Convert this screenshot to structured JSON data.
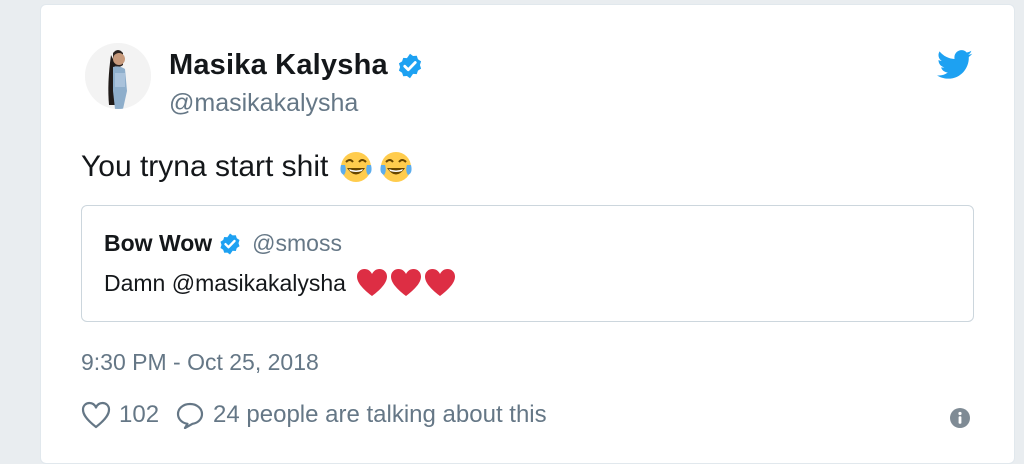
{
  "author": {
    "name": "Masika Kalysha",
    "handle": "@masikakalysha",
    "verified": true
  },
  "tweet": {
    "text": "You tryna start shit",
    "emojis": [
      "face-with-tears-of-joy",
      "face-with-tears-of-joy"
    ],
    "timestamp": "9:30 PM - Oct 25, 2018"
  },
  "quoted_tweet": {
    "name": "Bow Wow",
    "handle": "@smoss",
    "verified": true,
    "text": "Damn @masikakalysha",
    "emojis": [
      "red-heart",
      "red-heart",
      "red-heart"
    ]
  },
  "actions": {
    "likes": "102",
    "talking_label": "24 people are talking about this"
  },
  "colors": {
    "twitter_blue": "#1da1f2",
    "text_primary": "#14171a",
    "text_secondary": "#657786",
    "heart_red": "#dd2e44",
    "border": "#ccd6dd"
  },
  "icons": [
    "twitter-bird-icon",
    "verified-badge-icon",
    "heart-outline-icon",
    "reply-bubble-icon",
    "info-icon"
  ]
}
